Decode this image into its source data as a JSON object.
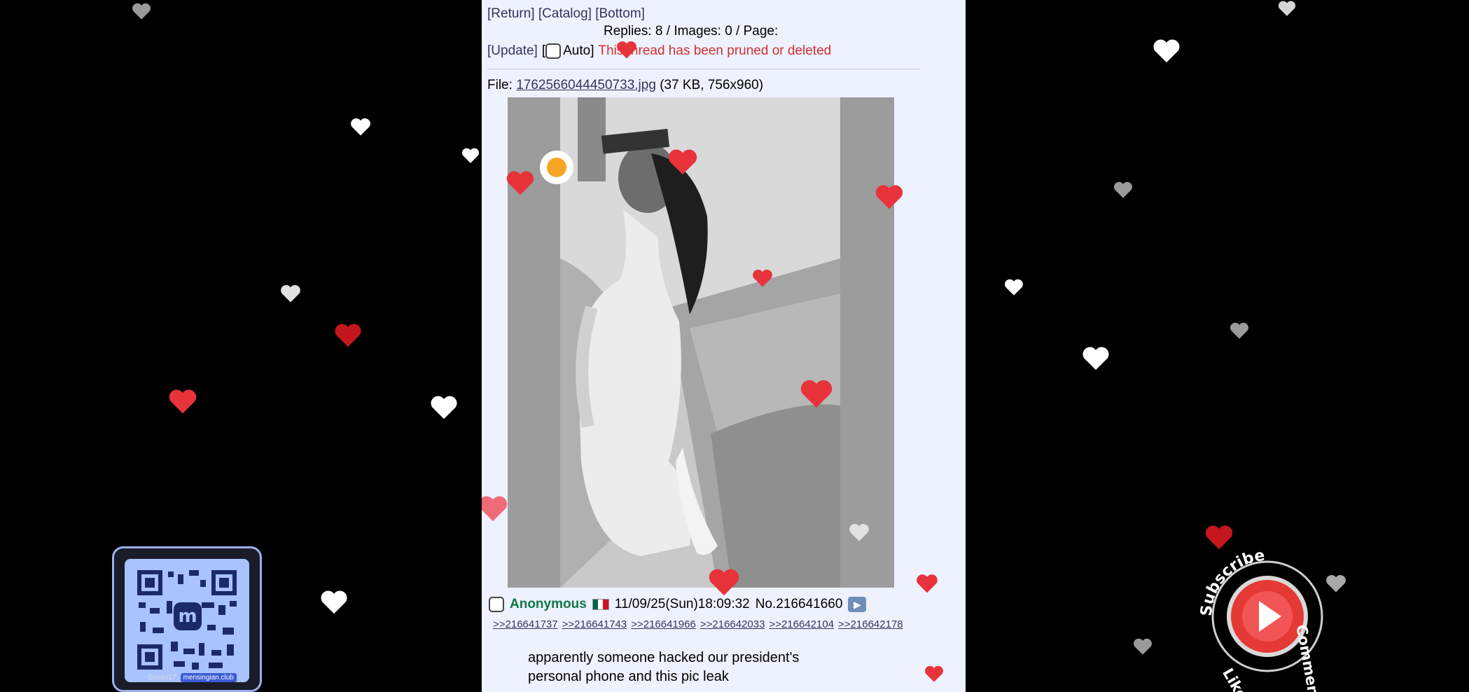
{
  "thread": {
    "nav": {
      "return_label": "[Return]",
      "catalog_label": "[Catalog]",
      "bottom_label": "[Bottom]"
    },
    "stats": "Replies: 8 / Images: 0 / Page: ",
    "update_label": "[Update]",
    "auto_label": "Auto]",
    "auto_open_bracket": "[",
    "status_message": "This thread has been pruned or deleted",
    "file": {
      "prefix": "File: ",
      "filename": "1762566044450733.jpg",
      "meta": "(37 KB, 756x960)"
    },
    "post": {
      "name": "Anonymous",
      "datetime": "11/09/25(Sun)18:09:32",
      "number": "No.216641660",
      "backlinks": [
        ">>216641737",
        ">>216641743",
        ">>216641966",
        ">>216642033",
        ">>216642104",
        ">>216642178"
      ],
      "message_line1": "apparently someone hacked our president's",
      "message_line2": "personal phone and this pic leak"
    }
  },
  "overlay": {
    "qr_caption": "Gonzo17",
    "qr_badge": "mensingian.club",
    "subscribe_words": [
      "Subscribe",
      "Comment",
      "Like"
    ]
  },
  "colors": {
    "link": "#34345c",
    "name_green": "#117743",
    "pruned_red": "#d32f2f",
    "panel_bg": "#eef2ff",
    "heart_red": "#e8333b",
    "heart_pink": "#f06b78"
  }
}
